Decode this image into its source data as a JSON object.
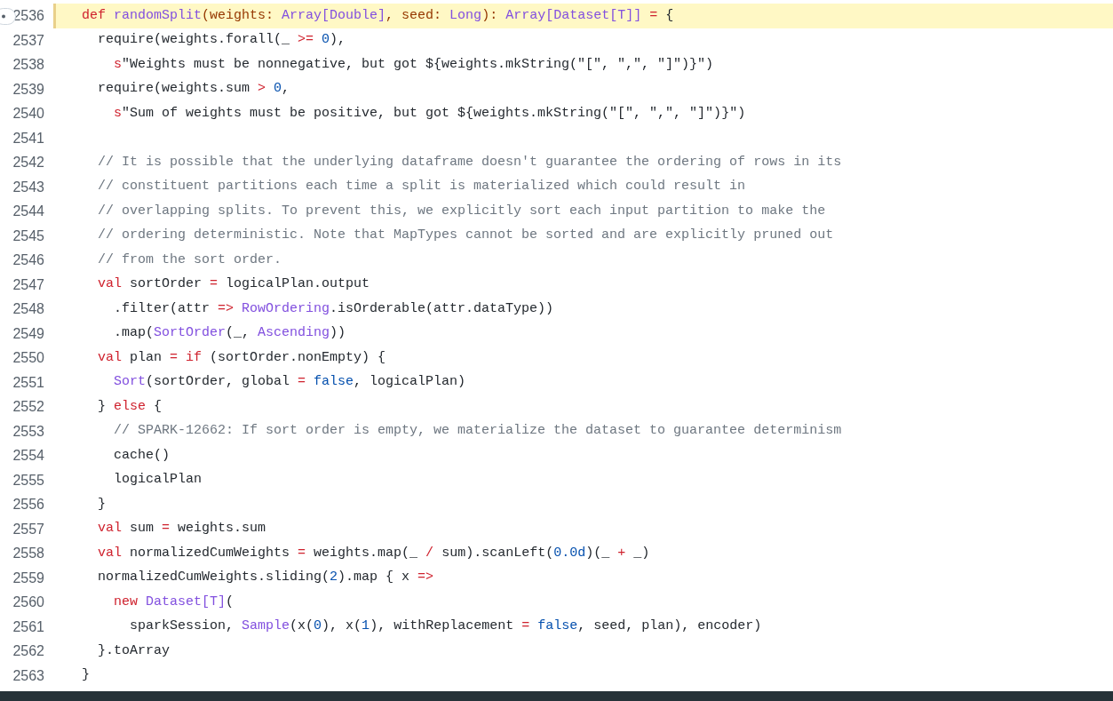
{
  "lines": [
    {
      "number": "2536",
      "highlighted": true,
      "tokens": [
        {
          "text": "  def ",
          "kind": "keyword"
        },
        {
          "text": "randomSplit",
          "kind": "type"
        },
        {
          "text": "(weights: ",
          "kind": "param"
        },
        {
          "text": "Array[Double]",
          "kind": "type"
        },
        {
          "text": ", seed: ",
          "kind": "param"
        },
        {
          "text": "Long",
          "kind": "type"
        },
        {
          "text": "): ",
          "kind": "param"
        },
        {
          "text": "Array[Dataset[T]]",
          "kind": "type"
        },
        {
          "text": " = ",
          "kind": "keyword"
        },
        {
          "text": "{",
          "kind": "plain"
        }
      ]
    },
    {
      "number": "2537",
      "highlighted": false,
      "tokens": [
        {
          "text": "    require(weights.forall(_ ",
          "kind": "plain"
        },
        {
          "text": ">= ",
          "kind": "keyword"
        },
        {
          "text": "0",
          "kind": "number"
        },
        {
          "text": "),",
          "kind": "plain"
        }
      ]
    },
    {
      "number": "2538",
      "highlighted": false,
      "tokens": [
        {
          "text": "      s",
          "kind": "keyword"
        },
        {
          "text": "\"Weights must be nonnegative, but got ${weights.mkString(\"[\", \",\", \"]\")}\")",
          "kind": "plain"
        }
      ]
    },
    {
      "number": "2539",
      "highlighted": false,
      "tokens": [
        {
          "text": "    require(weights.sum ",
          "kind": "plain"
        },
        {
          "text": "> ",
          "kind": "keyword"
        },
        {
          "text": "0",
          "kind": "number"
        },
        {
          "text": ",",
          "kind": "plain"
        }
      ]
    },
    {
      "number": "2540",
      "highlighted": false,
      "tokens": [
        {
          "text": "      s",
          "kind": "keyword"
        },
        {
          "text": "\"Sum of weights must be positive, but got ${weights.mkString(\"[\", \",\", \"]\")}\")",
          "kind": "plain"
        }
      ]
    },
    {
      "number": "2541",
      "highlighted": false
    },
    {
      "number": "2542",
      "highlighted": false,
      "tokens": [
        {
          "text": "    // It is possible that the underlying dataframe doesn't guarantee the ordering of rows in its",
          "kind": "comment"
        }
      ]
    },
    {
      "number": "2543",
      "highlighted": false,
      "tokens": [
        {
          "text": "    // constituent partitions each time a split is materialized which could result in",
          "kind": "comment"
        }
      ]
    },
    {
      "number": "2544",
      "highlighted": false,
      "tokens": [
        {
          "text": "    // overlapping splits. To prevent this, we explicitly sort each input partition to make the",
          "kind": "comment"
        }
      ]
    },
    {
      "number": "2545",
      "highlighted": false,
      "tokens": [
        {
          "text": "    // ordering deterministic. Note that MapTypes cannot be sorted and are explicitly pruned out",
          "kind": "comment"
        }
      ]
    },
    {
      "number": "2546",
      "highlighted": false,
      "tokens": [
        {
          "text": "    // from the sort order.",
          "kind": "comment"
        }
      ]
    },
    {
      "number": "2547",
      "highlighted": false,
      "tokens": [
        {
          "text": "    val",
          "kind": "keyword"
        },
        {
          "text": " sortOrder ",
          "kind": "plain"
        },
        {
          "text": "=",
          "kind": "keyword"
        },
        {
          "text": " logicalPlan.output",
          "kind": "plain"
        }
      ]
    },
    {
      "number": "2548",
      "highlighted": false,
      "tokens": [
        {
          "text": "      .filter(attr ",
          "kind": "plain"
        },
        {
          "text": "=> ",
          "kind": "keyword"
        },
        {
          "text": "RowOrdering",
          "kind": "type"
        },
        {
          "text": ".isOrderable(attr.dataType))",
          "kind": "plain"
        }
      ]
    },
    {
      "number": "2549",
      "highlighted": false,
      "tokens": [
        {
          "text": "      .map(",
          "kind": "plain"
        },
        {
          "text": "SortOrder",
          "kind": "type"
        },
        {
          "text": "(_, ",
          "kind": "plain"
        },
        {
          "text": "Ascending",
          "kind": "type"
        },
        {
          "text": "))",
          "kind": "plain"
        }
      ]
    },
    {
      "number": "2550",
      "highlighted": false,
      "tokens": [
        {
          "text": "    val",
          "kind": "keyword"
        },
        {
          "text": " plan ",
          "kind": "plain"
        },
        {
          "text": "= if",
          "kind": "keyword"
        },
        {
          "text": " (sortOrder.nonEmpty) {",
          "kind": "plain"
        }
      ]
    },
    {
      "number": "2551",
      "highlighted": false,
      "tokens": [
        {
          "text": "      Sort",
          "kind": "type"
        },
        {
          "text": "(sortOrder, global ",
          "kind": "plain"
        },
        {
          "text": "=",
          "kind": "keyword"
        },
        {
          "text": " false",
          "kind": "number"
        },
        {
          "text": ", logicalPlan)",
          "kind": "plain"
        }
      ]
    },
    {
      "number": "2552",
      "highlighted": false,
      "tokens": [
        {
          "text": "    } ",
          "kind": "plain"
        },
        {
          "text": "else",
          "kind": "keyword"
        },
        {
          "text": " {",
          "kind": "plain"
        }
      ]
    },
    {
      "number": "2553",
      "highlighted": false,
      "tokens": [
        {
          "text": "      // SPARK-12662: If sort order is empty, we materialize the dataset to guarantee determinism",
          "kind": "comment"
        }
      ]
    },
    {
      "number": "2554",
      "highlighted": false,
      "tokens": [
        {
          "text": "      cache()",
          "kind": "plain"
        }
      ]
    },
    {
      "number": "2555",
      "highlighted": false,
      "tokens": [
        {
          "text": "      logicalPlan",
          "kind": "plain"
        }
      ]
    },
    {
      "number": "2556",
      "highlighted": false,
      "tokens": [
        {
          "text": "    }",
          "kind": "plain"
        }
      ]
    },
    {
      "number": "2557",
      "highlighted": false,
      "tokens": [
        {
          "text": "    val",
          "kind": "keyword"
        },
        {
          "text": " sum ",
          "kind": "plain"
        },
        {
          "text": "=",
          "kind": "keyword"
        },
        {
          "text": " weights.sum",
          "kind": "plain"
        }
      ]
    },
    {
      "number": "2558",
      "highlighted": false,
      "tokens": [
        {
          "text": "    val",
          "kind": "keyword"
        },
        {
          "text": " normalizedCumWeights ",
          "kind": "plain"
        },
        {
          "text": "=",
          "kind": "keyword"
        },
        {
          "text": " weights.map(_ ",
          "kind": "plain"
        },
        {
          "text": "/",
          "kind": "keyword"
        },
        {
          "text": " sum).scanLeft(",
          "kind": "plain"
        },
        {
          "text": "0.0d",
          "kind": "number"
        },
        {
          "text": ")(_ ",
          "kind": "plain"
        },
        {
          "text": "+",
          "kind": "keyword"
        },
        {
          "text": " _)",
          "kind": "plain"
        }
      ]
    },
    {
      "number": "2559",
      "highlighted": false,
      "tokens": [
        {
          "text": "    normalizedCumWeights.sliding(",
          "kind": "plain"
        },
        {
          "text": "2",
          "kind": "number"
        },
        {
          "text": ").map { x ",
          "kind": "plain"
        },
        {
          "text": "=>",
          "kind": "keyword"
        }
      ]
    },
    {
      "number": "2560",
      "highlighted": false,
      "tokens": [
        {
          "text": "      new ",
          "kind": "keyword"
        },
        {
          "text": "Dataset[T]",
          "kind": "type"
        },
        {
          "text": "(",
          "kind": "plain"
        }
      ]
    },
    {
      "number": "2561",
      "highlighted": false,
      "tokens": [
        {
          "text": "        sparkSession, ",
          "kind": "plain"
        },
        {
          "text": "Sample",
          "kind": "type"
        },
        {
          "text": "(x(",
          "kind": "plain"
        },
        {
          "text": "0",
          "kind": "number"
        },
        {
          "text": "), x(",
          "kind": "plain"
        },
        {
          "text": "1",
          "kind": "number"
        },
        {
          "text": "), withReplacement ",
          "kind": "plain"
        },
        {
          "text": "=",
          "kind": "keyword"
        },
        {
          "text": " false",
          "kind": "number"
        },
        {
          "text": ", seed, plan), encoder)",
          "kind": "plain"
        }
      ]
    },
    {
      "number": "2562",
      "highlighted": false,
      "tokens": [
        {
          "text": "    }.toArray",
          "kind": "plain"
        }
      ]
    },
    {
      "number": "2563",
      "highlighted": false,
      "tokens": [
        {
          "text": "  }",
          "kind": "plain"
        }
      ]
    }
  ]
}
